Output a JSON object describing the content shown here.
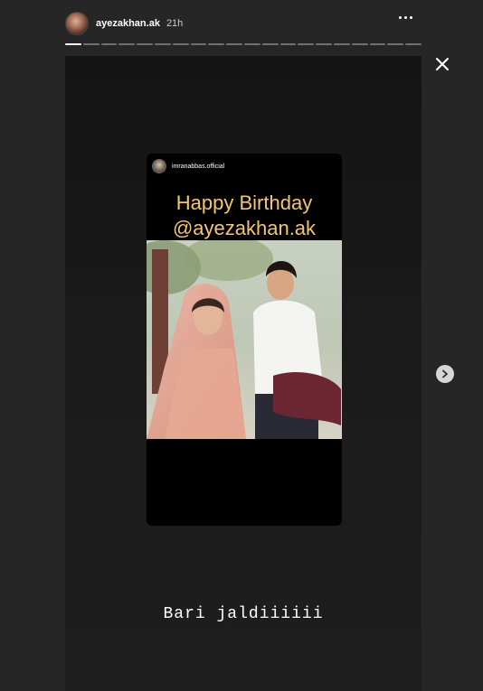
{
  "header": {
    "username": "ayezakhan.ak",
    "timestamp": "21h",
    "more_icon": "more-horizontal-icon"
  },
  "progress": {
    "total_segments": 20,
    "current_segment": 1
  },
  "close_icon": "close-icon",
  "shared_post": {
    "username": "imranabbas.official",
    "headline_line1": "Happy Birthday",
    "headline_line2": "@ayezakhan.ak",
    "accent_color": "#f2c76f"
  },
  "caption": "Bari jaldiiiiii",
  "next_icon": "chevron-right-icon"
}
